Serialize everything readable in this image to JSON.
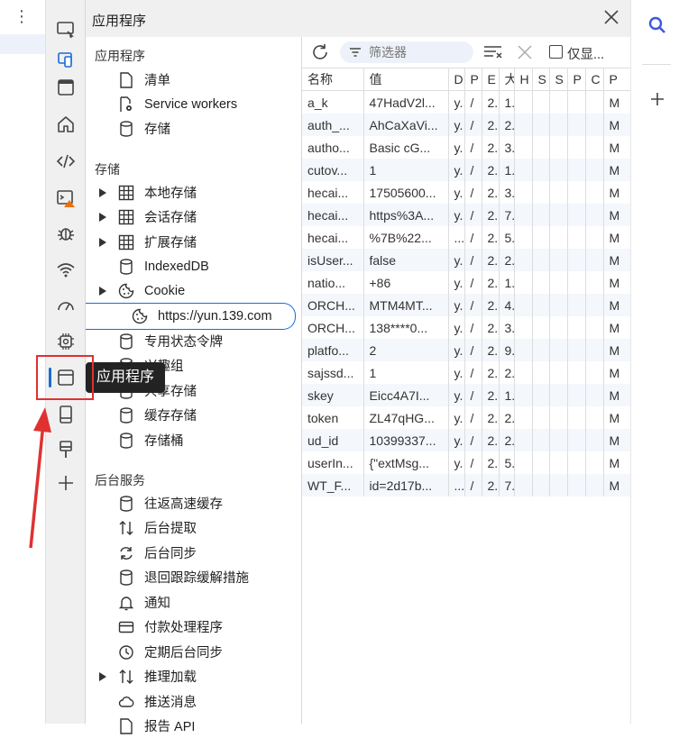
{
  "panel": {
    "title": "应用程序",
    "close_icon": "close-icon"
  },
  "tooltip": "应用程序",
  "tree": {
    "section_app": "应用程序",
    "app_items": [
      {
        "label": "清单",
        "icon": "file-icon"
      },
      {
        "label": "Service workers",
        "icon": "gear-icon"
      },
      {
        "label": "存储",
        "icon": "database-icon"
      }
    ],
    "section_storage": "存储",
    "storage_items": [
      {
        "label": "本地存储",
        "icon": "grid-icon",
        "expandable": true
      },
      {
        "label": "会话存储",
        "icon": "grid-icon",
        "expandable": true
      },
      {
        "label": "扩展存储",
        "icon": "grid-icon",
        "expandable": true
      },
      {
        "label": "IndexedDB",
        "icon": "database-icon",
        "expandable": false
      },
      {
        "label": "Cookie",
        "icon": "cookie-icon",
        "expandable": true
      },
      {
        "label": "https://yun.139.com",
        "icon": "cookie-icon",
        "selected": true
      },
      {
        "label": "专用状态令牌",
        "icon": "database-icon"
      },
      {
        "label": "兴趣组",
        "icon": "database-icon"
      },
      {
        "label": "共享存储",
        "icon": "database-icon"
      },
      {
        "label": "缓存存储",
        "icon": "database-icon"
      },
      {
        "label": "存储桶",
        "icon": "database-icon"
      }
    ],
    "section_background": "后台服务",
    "background_items": [
      {
        "label": "往返高速缓存",
        "icon": "database-icon"
      },
      {
        "label": "后台提取",
        "icon": "arrows-updown-icon"
      },
      {
        "label": "后台同步",
        "icon": "sync-icon"
      },
      {
        "label": "退回跟踪缓解措施",
        "icon": "database-icon"
      },
      {
        "label": "通知",
        "icon": "bell-icon"
      },
      {
        "label": "付款处理程序",
        "icon": "card-icon"
      },
      {
        "label": "定期后台同步",
        "icon": "clock-icon"
      },
      {
        "label": "推理加载",
        "icon": "arrows-updown-icon",
        "expandable": true
      },
      {
        "label": "推送消息",
        "icon": "cloud-icon"
      },
      {
        "label": "报告 API",
        "icon": "file-icon"
      }
    ]
  },
  "toolbar": {
    "filter_placeholder": "筛选器",
    "only_label": "仅显..."
  },
  "table": {
    "headers": [
      "名称",
      "值",
      "D",
      "P",
      "E",
      "大",
      "H",
      "S",
      "S",
      "P",
      "C",
      "P"
    ],
    "rows": [
      [
        "a_k",
        "47HadV2l...",
        "y.",
        "/",
        "2.",
        "1.",
        "",
        "",
        "",
        "",
        "",
        "M"
      ],
      [
        "auth_...",
        "AhCaXaVi...",
        "y.",
        "/",
        "2.",
        "2.",
        "",
        "",
        "",
        "",
        "",
        "M"
      ],
      [
        "autho...",
        "Basic cG...",
        "y.",
        "/",
        "2.",
        "3.",
        "",
        "",
        "",
        "",
        "",
        "M"
      ],
      [
        "cutov...",
        "1",
        "y.",
        "/",
        "2.",
        "1.",
        "",
        "",
        "",
        "",
        "",
        "M"
      ],
      [
        "hecai...",
        "17505600...",
        "y.",
        "/",
        "2.",
        "3.",
        "",
        "",
        "",
        "",
        "",
        "M"
      ],
      [
        "hecai...",
        "https%3A...",
        "y.",
        "/",
        "2.",
        "7.",
        "",
        "",
        "",
        "",
        "",
        "M"
      ],
      [
        "hecai...",
        "%7B%22...",
        "...",
        "/",
        "2.",
        "5.",
        "",
        "",
        "",
        "",
        "",
        "M"
      ],
      [
        "isUser...",
        "false",
        "y.",
        "/",
        "2.",
        "2.",
        "",
        "",
        "",
        "",
        "",
        "M"
      ],
      [
        "natio...",
        "+86",
        "y.",
        "/",
        "2.",
        "1.",
        "",
        "",
        "",
        "",
        "",
        "M"
      ],
      [
        "ORCH...",
        "MTM4MT...",
        "y.",
        "/",
        "2.",
        "4.",
        "",
        "",
        "",
        "",
        "",
        "M"
      ],
      [
        "ORCH...",
        "138****0...",
        "y.",
        "/",
        "2.",
        "3.",
        "",
        "",
        "",
        "",
        "",
        "M"
      ],
      [
        "platfo...",
        "2",
        "y.",
        "/",
        "2.",
        "9.",
        "",
        "",
        "",
        "",
        "",
        "M"
      ],
      [
        "sajssd...",
        "1",
        "y.",
        "/",
        "2.",
        "2.",
        "",
        "",
        "",
        "",
        "",
        "M"
      ],
      [
        "skey",
        "Eicc4A7I...",
        "y.",
        "/",
        "2.",
        "1.",
        "",
        "",
        "",
        "",
        "",
        "M"
      ],
      [
        "token",
        "ZL47qHG...",
        "y.",
        "/",
        "2.",
        "2.",
        "",
        "",
        "",
        "",
        "",
        "M"
      ],
      [
        "ud_id",
        "10399337...",
        "y.",
        "/",
        "2.",
        "2.",
        "",
        "",
        "",
        "",
        "",
        "M"
      ],
      [
        "userIn...",
        "{\"extMsg...",
        "y.",
        "/",
        "2.",
        "5.",
        "",
        "",
        "",
        "",
        "",
        "M"
      ],
      [
        "WT_F...",
        "id=2d17b...",
        "...",
        "/",
        "2.",
        "7.",
        "",
        "",
        "",
        "",
        "",
        "M"
      ]
    ]
  },
  "colors": {
    "accent": "#1a6bd6",
    "annotation": "#e03131",
    "warning": "#e8710a"
  }
}
